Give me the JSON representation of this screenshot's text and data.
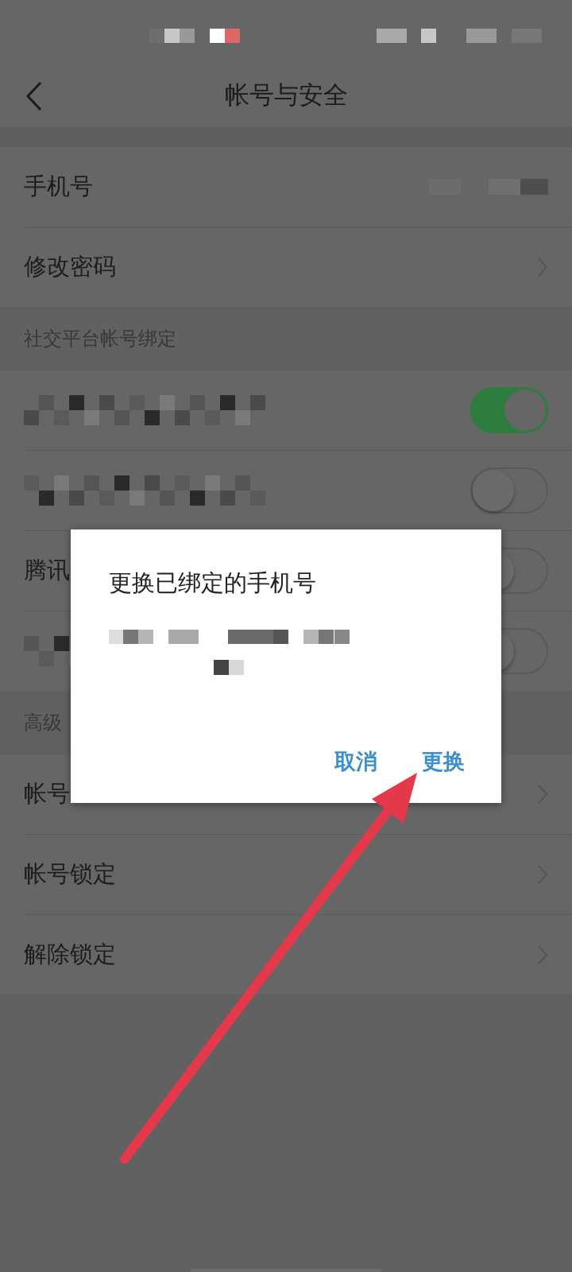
{
  "header": {
    "title": "帐号与安全"
  },
  "account_rows": [
    {
      "label": "手机号",
      "kind": "value"
    },
    {
      "label": "修改密码",
      "kind": "link"
    }
  ],
  "social_section": {
    "title": "社交平台帐号绑定"
  },
  "social_rows": [
    {
      "kind": "redacted",
      "on": true
    },
    {
      "kind": "redacted",
      "on": false
    },
    {
      "kind": "text",
      "label": "腾讯",
      "on": false
    },
    {
      "kind": "redacted",
      "on": false
    }
  ],
  "advanced_section": {
    "title": "高级"
  },
  "advanced_rows": [
    {
      "label": "帐号"
    },
    {
      "label": "帐号锁定"
    },
    {
      "label": "解除锁定"
    }
  ],
  "dialog": {
    "title": "更换已绑定的手机号",
    "buttons": [
      "取消",
      "更换"
    ]
  }
}
